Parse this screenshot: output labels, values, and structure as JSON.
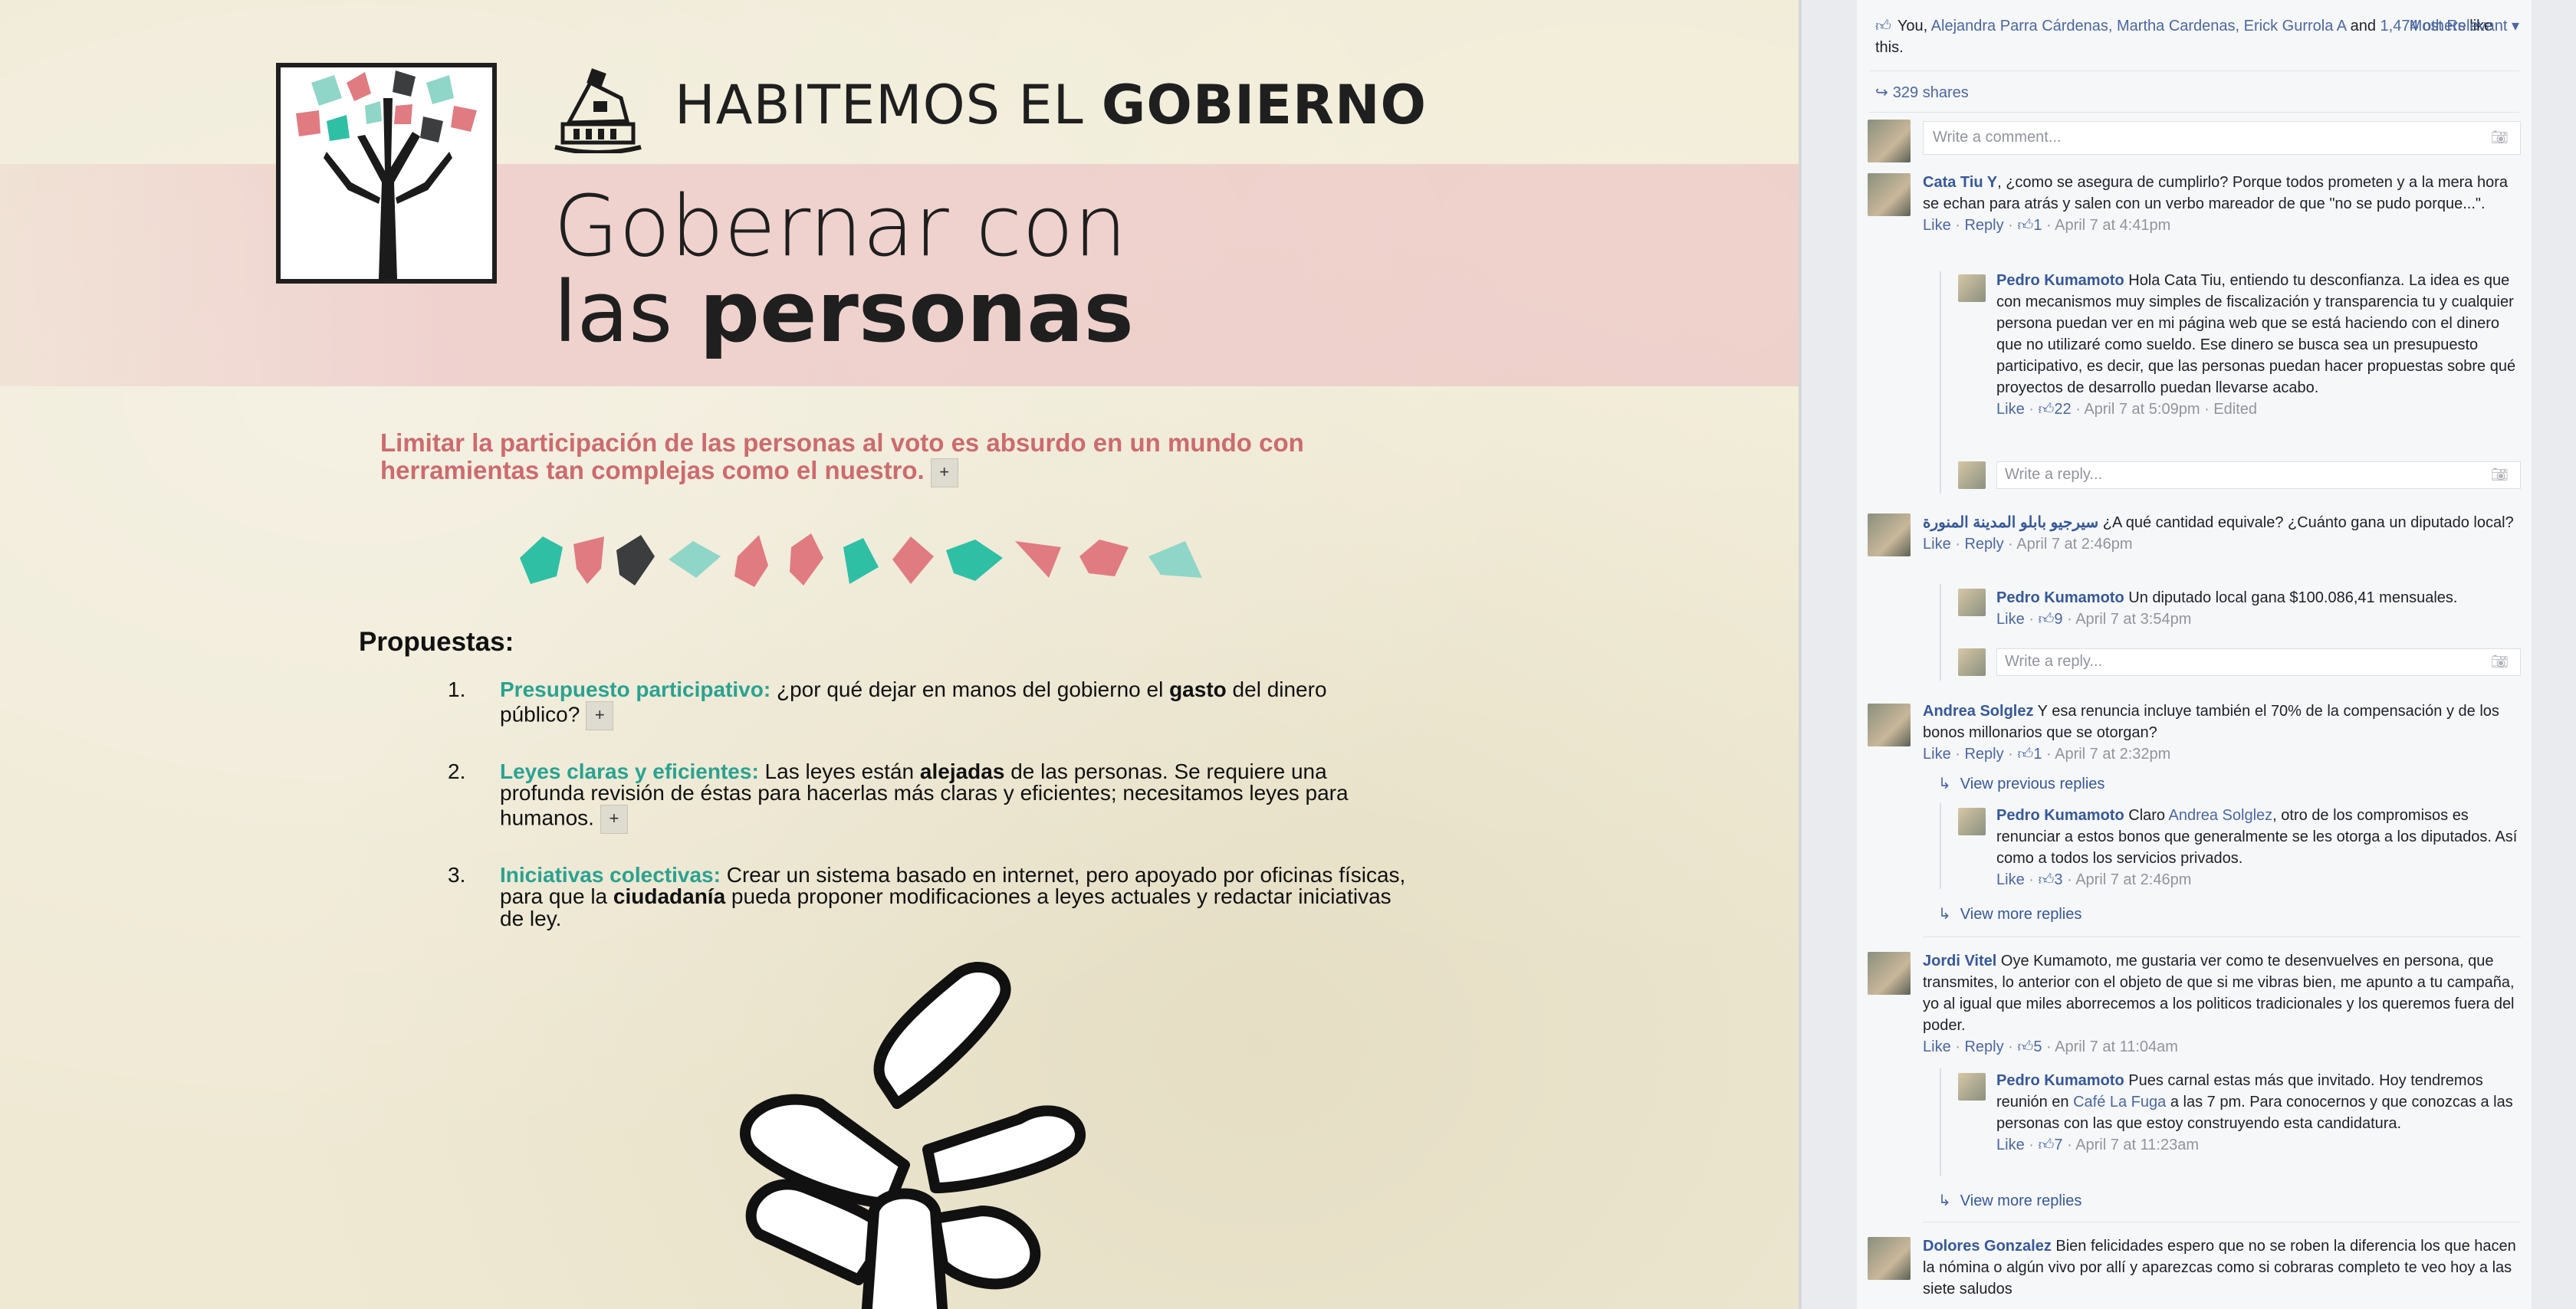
{
  "poster": {
    "org_name_light": "HABITEMOS EL",
    "org_name_bold": "GOBIERNO",
    "headline_line1": "Gobernar con",
    "headline_line2_light": "las",
    "headline_line2_bold": "personas",
    "quote": "Limitar la participación de las personas al voto es absurdo en un mundo con herramientas tan complejas como el nuestro.",
    "expand_label": "+",
    "section_title": "Propuestas:",
    "proposals": [
      {
        "num": "1.",
        "title": "Presupuesto participativo:",
        "t1": " ¿por qué dejar en manos del gobierno el ",
        "b1": "gasto",
        "t2": " del dinero público?"
      },
      {
        "num": "2.",
        "title": "Leyes claras y eficientes:",
        "t1": " Las leyes están ",
        "b1": "alejadas",
        "t2": " de las personas. Se requiere una profunda revisión de éstas para hacerlas más claras y eficientes; necesitamos leyes para humanos."
      },
      {
        "num": "3.",
        "title": "Iniciativas colectivas:",
        "t1": " Crear un sistema basado en internet, pero apoyado por oficinas físicas, para que la ",
        "b1": "ciudadanía",
        "t2": " pueda proponer modificaciones a leyes actuales y redactar iniciativas de ley."
      }
    ],
    "colors": {
      "teal": "#2fbfa5",
      "pink": "#e07b82",
      "dark": "#3b3d3f",
      "mint": "#8fd6c8",
      "headline": "#1f1f1f",
      "quote": "#cc6b6f"
    }
  },
  "fb": {
    "likes_you": "You, ",
    "likes_names": "Alejandra Parra Cárdenas, Martha Cardenas, Erick Gurrola A",
    "likes_and": " and ",
    "likes_others": "1,474 others",
    "likes_tail": " like this.",
    "most_relevant": "Most Relevant ▾",
    "shares": "329 shares",
    "comment_placeholder": "Write a comment...",
    "reply_placeholder": "Write a reply...",
    "like": "Like",
    "reply": "Reply",
    "view_previous": "View previous replies",
    "view_more": "View more replies",
    "comments": [
      {
        "name": "Cata Tiu Y",
        "text": ", ¿como se asegura de cumplirlo? Porque todos prometen y a la mera hora se echan para atrás y salen con un verbo mareador de que \"no se pudo porque...\".",
        "likes": "1",
        "time": "April 7 at 4:41pm"
      },
      {
        "name": "Pedro Kumamoto",
        "text": " Hola Cata Tiu, entiendo tu desconfianza. La idea es que con mecanismos muy simples de fiscalización y transparencia tu y cualquier persona puedan ver en mi página web que se está haciendo con el dinero que no utilizaré como sueldo. Ese dinero se busca sea un presupuesto participativo, es decir, que las personas puedan hacer propuestas sobre qué proyectos de desarrollo puedan llevarse acabo.",
        "likes": "22",
        "time": "April 7 at 5:09pm",
        "edited": " · Edited"
      },
      {
        "name": "سيرجيو بابلو المدينة المنورة",
        "text": " ¿A qué cantidad equivale? ¿Cuánto gana un diputado local?",
        "time": "April 7 at 2:46pm"
      },
      {
        "name": "Pedro Kumamoto",
        "text": " Un diputado local gana $100.086,41 mensuales.",
        "likes": "9",
        "time": "April 7 at 3:54pm"
      },
      {
        "name": "Andrea Solglez",
        "text": " Y esa renuncia incluye también el 70% de la compensación y de los bonos millonarios que se otorgan?",
        "likes": "1",
        "time": "April 7 at 2:32pm"
      },
      {
        "name": "Pedro Kumamoto",
        "text_a": " Claro ",
        "mention": "Andrea Solglez",
        "text_b": ", otro de los compromisos es renunciar a estos bonos que generalmente se les otorga a los diputados. Así como a todos los servicios privados.",
        "likes": "3",
        "time": "April 7 at 2:46pm"
      },
      {
        "name": "Jordi Vitel",
        "text": " Oye Kumamoto, me gustaria ver como te desenvuelves en persona, que transmites, lo anterior con el objeto de que si me vibras bien, me apunto a tu campaña, yo al igual que miles aborrecemos a los politicos tradicionales y los queremos fuera del poder.",
        "likes": "5",
        "time": "April 7 at 11:04am"
      },
      {
        "name": "Pedro Kumamoto",
        "text_a": " Pues carnal estas más que invitado. Hoy tendremos reunión en ",
        "mention": "Café La Fuga",
        "text_b": " a las 7 pm. Para conocernos y que conozcas a las personas con las que estoy construyendo esta candidatura.",
        "likes": "7",
        "time": "April 7 at 11:23am"
      },
      {
        "name": "Dolores Gonzalez",
        "text": " Bien felicidades espero que no se roben la diferencia los que hacen la nómina o algún vivo por allí y aparezcas como si cobraras completo te veo hoy a las siete saludos"
      }
    ]
  }
}
